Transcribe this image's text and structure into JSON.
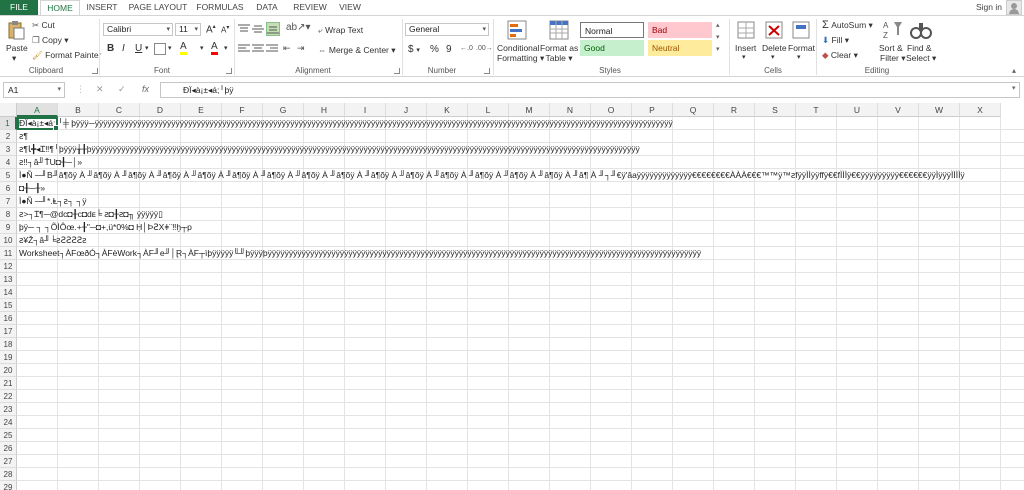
{
  "tabs": {
    "file": "FILE",
    "home": "HOME",
    "insert": "INSERT",
    "page_layout": "PAGE LAYOUT",
    "formulas": "FORMULAS",
    "data": "DATA",
    "review": "REVIEW",
    "view": "VIEW",
    "sign_in": "Sign in"
  },
  "ribbon": {
    "clipboard": {
      "paste": "Paste",
      "cut": "Cut",
      "copy": "Copy",
      "format_painter": "Format Painter",
      "label": "Clipboard"
    },
    "font": {
      "name": "Calibri",
      "size": "11",
      "grow": "A",
      "shrink": "A",
      "bold": "B",
      "italic": "I",
      "underline": "U",
      "fill": "A",
      "color": "A",
      "label": "Font"
    },
    "alignment": {
      "wrap_text": "Wrap Text",
      "merge_center": "Merge & Center",
      "label": "Alignment"
    },
    "number": {
      "format": "General",
      "currency": "$",
      "percent": "%",
      "comma": "9",
      "label": "Number"
    },
    "styles": {
      "conditional_formatting_1": "Conditional",
      "conditional_formatting_2": "Formatting",
      "format_as_table_1": "Format as",
      "format_as_table_2": "Table",
      "normal": "Normal",
      "bad": "Bad",
      "good": "Good",
      "neutral": "Neutral",
      "label": "Styles"
    },
    "cells": {
      "insert": "Insert",
      "delete": "Delete",
      "format": "Format",
      "label": "Cells"
    },
    "editing": {
      "autosum": "AutoSum",
      "fill": "Fill",
      "clear": "Clear",
      "sort_filter_1": "Sort &",
      "sort_filter_2": "Filter",
      "find_select_1": "Find &",
      "find_select_2": "Select",
      "label": "Editing"
    }
  },
  "formula_bar": {
    "name_box": "A1",
    "fx": "fx",
    "value": "ÐÏ◂à¡±◂á;╵þÿ"
  },
  "columns": [
    "A",
    "B",
    "C",
    "D",
    "E",
    "F",
    "G",
    "H",
    "I",
    "J",
    "K",
    "L",
    "M",
    "N",
    "O",
    "P",
    "Q",
    "R",
    "S",
    "T",
    "U",
    "V",
    "W",
    "X"
  ],
  "rows": [
    {
      "num": "1",
      "text": "     ÐÏ◂à¡±◂á;     ╵╪        þÿÿÿ─ÿÿÿÿÿÿÿÿÿÿÿÿÿÿÿÿÿÿÿÿÿÿÿÿÿÿÿÿÿÿÿÿÿÿÿÿÿÿÿÿÿÿÿÿÿÿÿÿÿÿÿÿÿÿÿÿÿÿÿÿÿÿÿÿÿÿÿÿÿÿÿÿÿÿÿÿÿÿÿÿÿÿÿÿÿÿÿÿÿÿÿÿÿÿÿÿÿÿÿÿÿÿÿÿÿÿÿÿÿÿÿÿÿÿÿÿÿÿÿÿÿÿÿÿÿÿÿÿÿÿÿÿÿÿÿÿ"
    },
    {
      "num": "2",
      "text": "  ꙅ¶"
    },
    {
      "num": "3",
      "text": "ꙅ¶Ꙇ╋◂Ɪ‼¶╵þÿÿÿ╁╂þÿÿÿÿÿÿÿÿÿÿÿÿÿÿÿÿÿÿÿÿÿÿÿÿÿÿÿÿÿÿÿÿÿÿÿÿÿÿÿÿÿÿÿÿÿÿÿÿÿÿÿÿÿÿÿÿÿÿÿÿÿÿÿÿÿÿÿÿÿÿÿÿÿÿÿÿÿÿÿÿÿÿÿÿÿÿÿÿÿÿÿÿÿÿÿÿÿÿÿÿÿÿÿÿÿÿÿÿÿÿÿÿÿÿÿÿÿÿÿÿÿÿÿÿÿÿÿÿÿ"
    },
    {
      "num": "4",
      "text": "ꙅ‼┐â╜ŤU◘╂─│»"
    },
    {
      "num": "5",
      "text": "Ì●Ñ    ─╜B╜â¶õÿ À    ╜â¶õÿ À    ╜â¶õÿ À    ╜â¶õÿ À    ╜â¶õÿ À    ╜â¶õÿ À    ╜â¶õÿ À    ╜â¶õÿ À    ╜â¶õÿ À    ╜â¶õÿ À    ╜â¶õÿ À    ╜â¶õÿ À    ╜â¶õÿ À    ╜â¶õÿ À    ╜â¶õÿ À    ╜â¶      À    ╜┐╜€ÿ'âaÿÿÿÿÿÿÿÿÿÿÿÿÿ€€€€€€€€ÀÀÀ€€€™™ÿ™ꙅfÿÿÌÌÿÿffÿ€€fÌÌÌÿ€€ÿÿÿÿÿÿÿÿÿ€€€€€€ÿÿÌÿÿÿÌÌÌÌÿ"
    },
    {
      "num": "6",
      "text": "               ◘╂─╂»"
    },
    {
      "num": "7",
      "text": "Ì●Ñ    ─╜*.Ⱡ┐ꙅ┐     ┐ÿ"
    },
    {
      "num": "8",
      "text": "ꙅ>┐Ɪ¶─@dᴄ◘╂ᴄ◘dᴇ╘         ꙅ◘╂ꙅ◘╖       ÿÿÿÿÿ▯"
    },
    {
      "num": "9",
      "text": "þÿ─    ┐    ┐ÕÌÔœ.+╂\"─◘+,ü*0%◘        Ḥ│ÞꙄXǂ¨‼ḫ┬p"
    },
    {
      "num": "10",
      "text": "ꙅ¥Ž┐â╜╘ꙅꙄꙄꙄꙄꙅ"
    },
    {
      "num": "11",
      "text": "Worksheet┐ÀFœðÓ┐ÀFèWork┐ÀF╜e╜│Ɽ┐ÀF┬ìþÿÿÿÿÿ╙╜þÿÿÿþÿÿÿÿÿÿÿÿÿÿÿÿÿÿÿÿÿÿÿÿÿÿÿÿÿÿÿÿÿÿÿÿÿÿÿÿÿÿÿÿÿÿÿÿÿÿÿÿÿÿÿÿÿÿÿÿÿÿÿÿÿÿÿÿÿÿÿÿÿÿÿÿÿÿÿÿÿÿÿÿÿÿÿÿÿÿÿÿÿÿÿÿÿÿÿÿÿÿÿÿÿÿ"
    },
    {
      "num": "12",
      "text": ""
    },
    {
      "num": "13",
      "text": ""
    },
    {
      "num": "14",
      "text": ""
    },
    {
      "num": "15",
      "text": ""
    },
    {
      "num": "16",
      "text": ""
    },
    {
      "num": "17",
      "text": ""
    },
    {
      "num": "18",
      "text": ""
    },
    {
      "num": "19",
      "text": ""
    },
    {
      "num": "20",
      "text": ""
    },
    {
      "num": "21",
      "text": ""
    },
    {
      "num": "22",
      "text": ""
    },
    {
      "num": "23",
      "text": ""
    },
    {
      "num": "24",
      "text": ""
    },
    {
      "num": "25",
      "text": ""
    },
    {
      "num": "26",
      "text": ""
    },
    {
      "num": "27",
      "text": ""
    },
    {
      "num": "28",
      "text": ""
    },
    {
      "num": "29",
      "text": ""
    }
  ],
  "colors": {
    "accent": "#217346",
    "bad_bg": "#ffc7ce",
    "bad_fg": "#9c0006",
    "good_bg": "#c6efce",
    "good_fg": "#006100",
    "neutral_bg": "#ffeb9c",
    "neutral_fg": "#9c5700"
  }
}
